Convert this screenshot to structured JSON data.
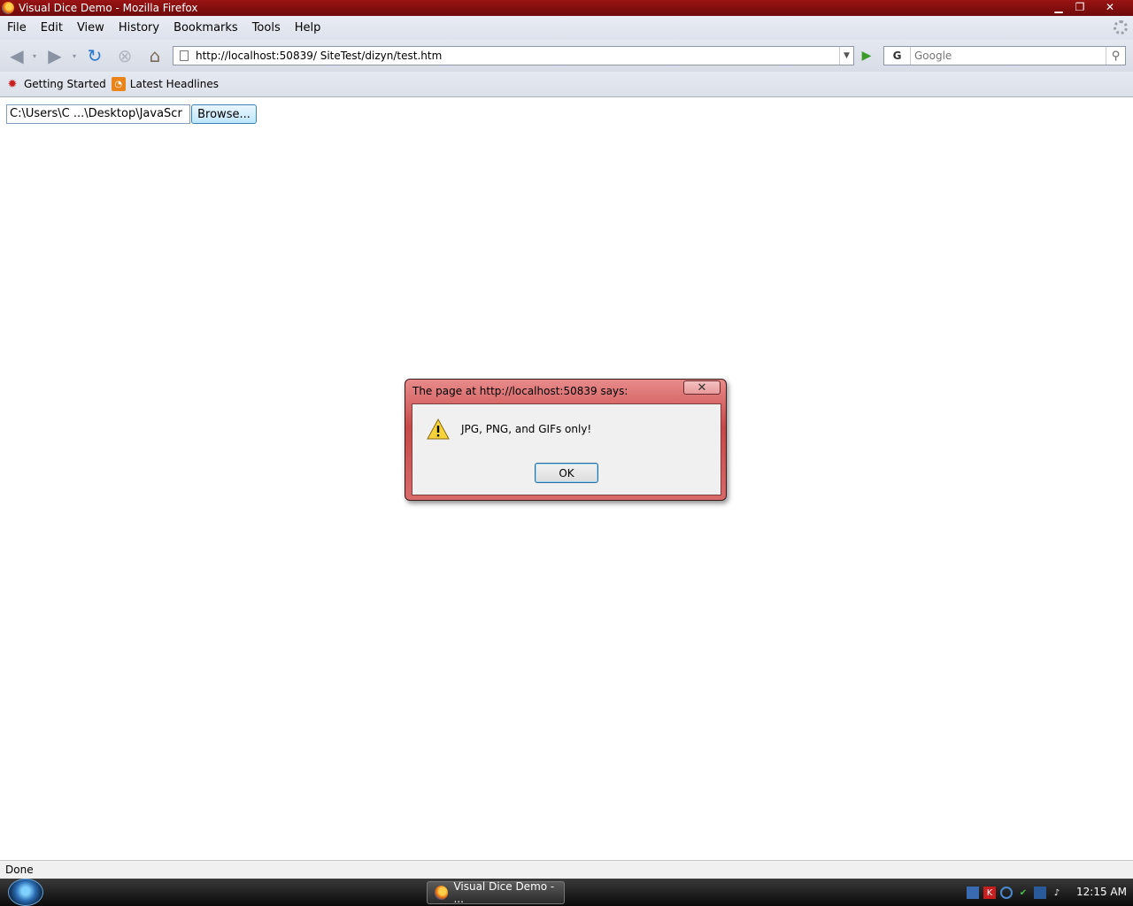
{
  "window": {
    "title": "Visual Dice Demo - Mozilla Firefox",
    "minimize_glyph": "▁",
    "restore_glyph": "❐",
    "close_glyph": "✕"
  },
  "menu": {
    "items": [
      "File",
      "Edit",
      "View",
      "History",
      "Bookmarks",
      "Tools",
      "Help"
    ]
  },
  "navigation": {
    "url": "http://localhost:50839/       SiteTest/dizyn/test.htm",
    "search_placeholder": "Google",
    "search_engine_icon": "G"
  },
  "bookmarks": {
    "items": [
      {
        "label": "Getting Started",
        "icon": "firefox-bookmark-icon"
      },
      {
        "label": "Latest Headlines",
        "icon": "rss-feed-icon"
      }
    ]
  },
  "page": {
    "file_input_value": "C:\\Users\\C     ...\\Desktop\\JavaScr",
    "browse_label": "Browse..."
  },
  "dialog": {
    "title": "The page at http://localhost:50839 says:",
    "message": "JPG, PNG, and GIFs only!",
    "ok_label": "OK",
    "close_glyph": "✕"
  },
  "status": {
    "text": "Done"
  },
  "taskbar": {
    "task_label": "Visual Dice Demo - ...",
    "clock": "12:15 AM"
  },
  "colors": {
    "titlebar": "#8b0f0f",
    "dialog_frame": "#c84848"
  }
}
